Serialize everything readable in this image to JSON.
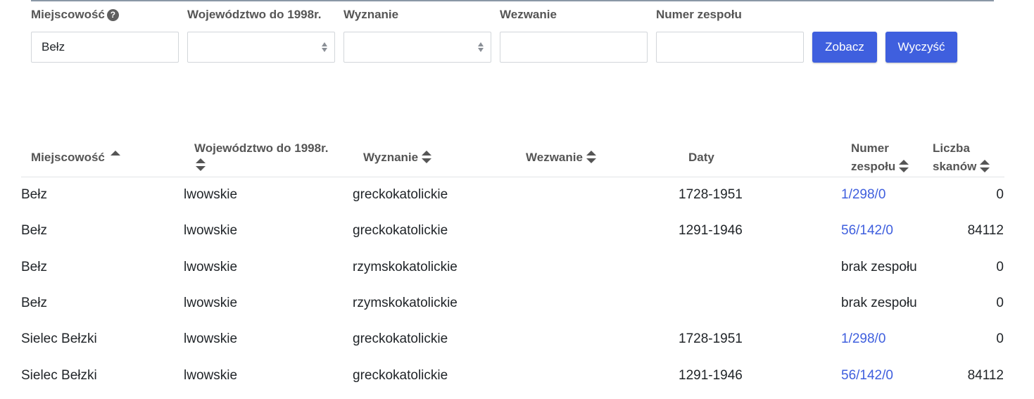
{
  "filters": {
    "miejscowosc_label": "Miejscowość",
    "miejscowosc_help": "?",
    "miejscowosc_value": "Bełz",
    "wojewodztwo_label": "Województwo do 1998r.",
    "wojewodztwo_value": "",
    "wyznanie_label": "Wyznanie",
    "wyznanie_value": "",
    "wezwanie_label": "Wezwanie",
    "wezwanie_value": "",
    "numer_label": "Numer zespołu",
    "numer_value": "",
    "submit_label": "Zobacz",
    "clear_label": "Wyczyść"
  },
  "table": {
    "headers": {
      "miejscowosc": "Miejscowość",
      "wojewodztwo": "Województwo do 1998r.",
      "wyznanie": "Wyznanie",
      "wezwanie": "Wezwanie",
      "daty": "Daty",
      "numer_line1": "Numer",
      "numer_line2": "zespołu",
      "liczba_line1": "Liczba",
      "liczba_line2": "skanów"
    },
    "rows": [
      {
        "miejscowosc": "Bełz",
        "wojewodztwo": "lwowskie",
        "wyznanie": "greckokatolickie",
        "wezwanie": "",
        "daty": "1728-1951",
        "numer": "1/298/0",
        "skany": "0"
      },
      {
        "miejscowosc": "Bełz",
        "wojewodztwo": "lwowskie",
        "wyznanie": "greckokatolickie",
        "wezwanie": "",
        "daty": "1291-1946",
        "numer": "56/142/0",
        "skany": "84112"
      },
      {
        "miejscowosc": "Bełz",
        "wojewodztwo": "lwowskie",
        "wyznanie": "rzymskokatolickie",
        "wezwanie": "",
        "daty": "",
        "numer": "brak zespołu",
        "skany": "0"
      },
      {
        "miejscowosc": "Bełz",
        "wojewodztwo": "lwowskie",
        "wyznanie": "rzymskokatolickie",
        "wezwanie": "",
        "daty": "",
        "numer": "brak zespołu",
        "skany": "0"
      },
      {
        "miejscowosc": "Sielec Bełzki",
        "wojewodztwo": "lwowskie",
        "wyznanie": "greckokatolickie",
        "wezwanie": "",
        "daty": "1728-1951",
        "numer": "1/298/0",
        "skany": "0"
      },
      {
        "miejscowosc": "Sielec Bełzki",
        "wojewodztwo": "lwowskie",
        "wyznanie": "greckokatolickie",
        "wezwanie": "",
        "daty": "1291-1946",
        "numer": "56/142/0",
        "skany": "84112"
      }
    ]
  },
  "colors": {
    "accent": "#3f5fde",
    "header_text": "#555555",
    "body_text": "#212529"
  }
}
